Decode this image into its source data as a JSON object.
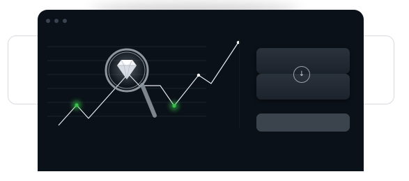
{
  "window": {
    "controls": [
      "window-dot",
      "window-dot",
      "window-dot"
    ]
  },
  "chart": {
    "series_color": "#ffffff",
    "marker_color": "#35c24a",
    "grid_color": "#1a222c"
  },
  "magnifier": {
    "icon": "diamond-icon"
  },
  "side_panel": {
    "action_icon": "download-arrow-icon",
    "action_glyph": "↓"
  },
  "colors": {
    "window_bg": "#0b1118",
    "button_bg": "#232b35",
    "accent_green": "#35c24a"
  }
}
